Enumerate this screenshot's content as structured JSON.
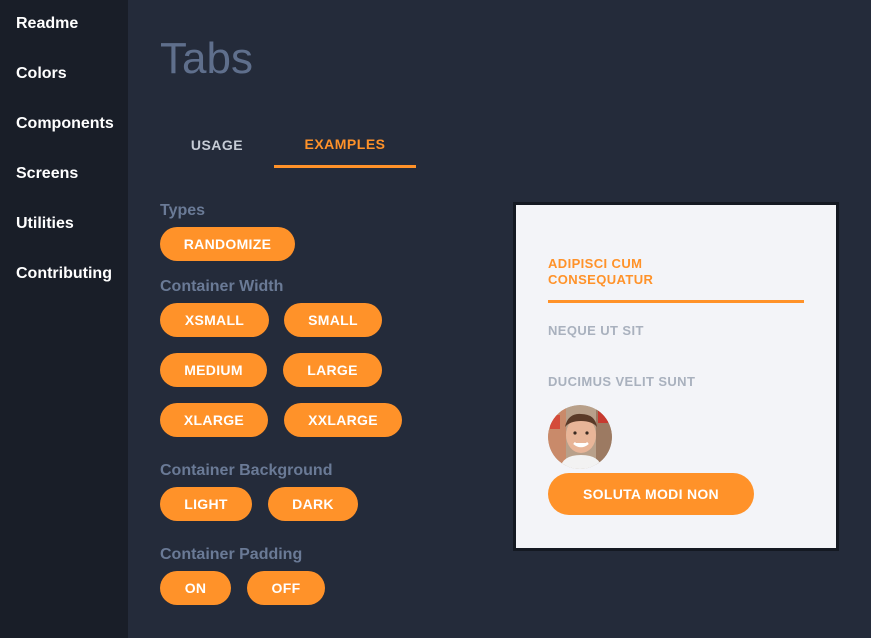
{
  "sidebar": {
    "items": [
      {
        "label": "Readme"
      },
      {
        "label": "Colors"
      },
      {
        "label": "Components"
      },
      {
        "label": "Screens"
      },
      {
        "label": "Utilities"
      },
      {
        "label": "Contributing"
      }
    ]
  },
  "page": {
    "title": "Tabs",
    "tabs": [
      {
        "label": "USAGE"
      },
      {
        "label": "EXAMPLES",
        "active": true
      }
    ]
  },
  "controls": {
    "types": {
      "label": "Types",
      "buttons": [
        "RANDOMIZE"
      ]
    },
    "container_width": {
      "label": "Container Width",
      "buttons": [
        "XSMALL",
        "SMALL",
        "MEDIUM",
        "LARGE",
        "XLARGE",
        "XXLARGE"
      ]
    },
    "container_background": {
      "label": "Container Background",
      "buttons": [
        "LIGHT",
        "DARK"
      ]
    },
    "container_padding": {
      "label": "Container Padding",
      "buttons": [
        "ON",
        "OFF"
      ]
    }
  },
  "preview": {
    "tabs": [
      {
        "label": "ADIPISCI CUM CONSEQUATUR",
        "active": true
      },
      {
        "label": "NEQUE UT SIT"
      },
      {
        "label": "DUCIMUS VELIT SUNT"
      }
    ],
    "button_label": "SOLUTA MODI NON"
  },
  "colors": {
    "accent": "#ff9229",
    "background": "#242b3a",
    "sidebar": "#191e28",
    "preview_bg": "#f3f4f8"
  }
}
